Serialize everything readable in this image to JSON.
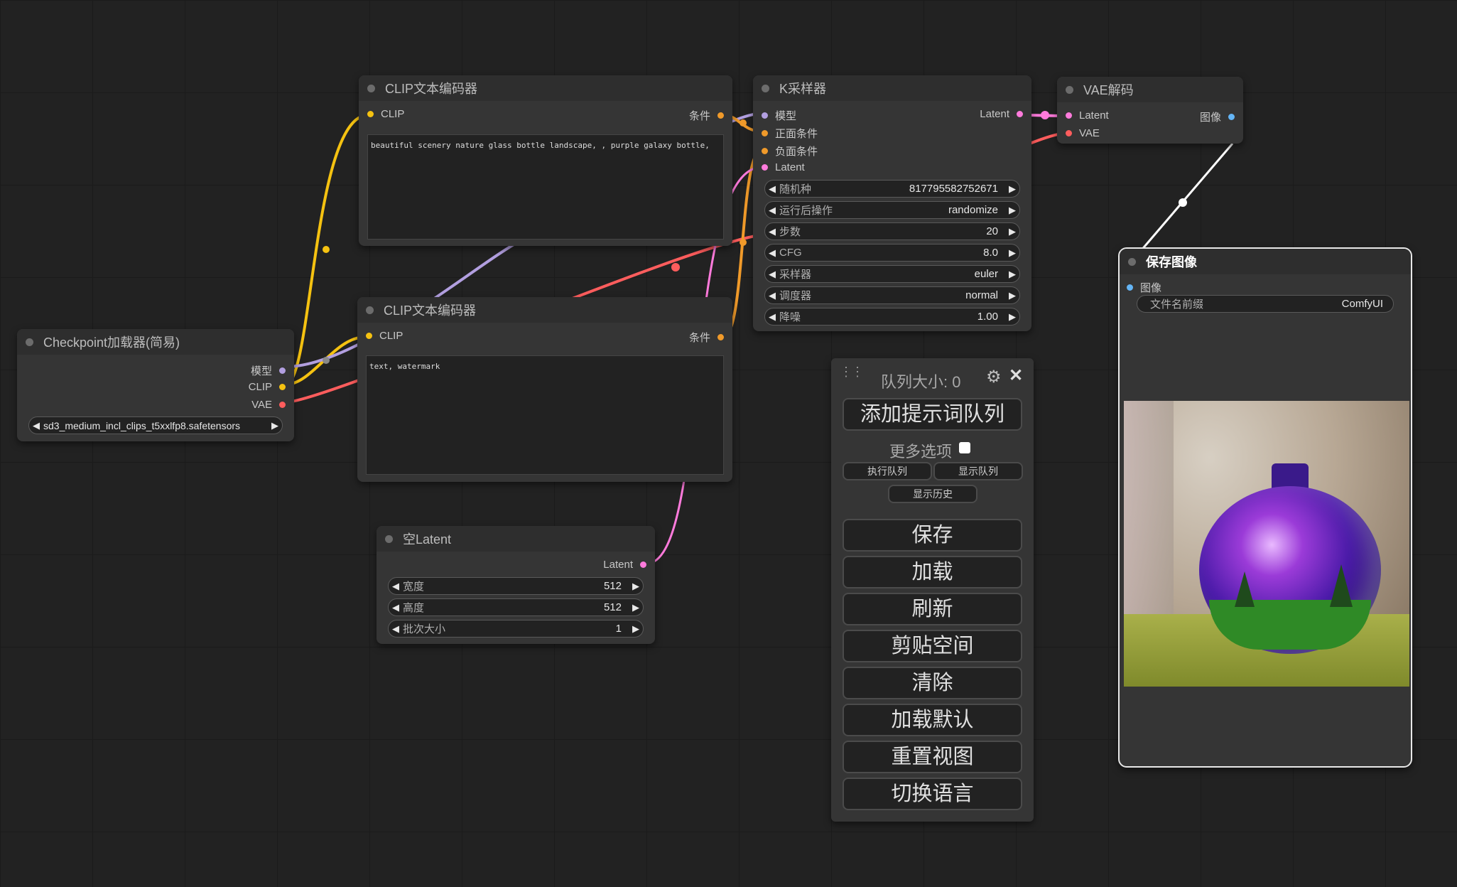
{
  "colors": {
    "background": "#222222",
    "clip_yellow": "#f5c211",
    "conditioning_orange": "#f09a2a",
    "latent_pink": "#ff7bdc",
    "vae_red": "#ff5d5d",
    "model_lavender": "#b29fe0",
    "image_blue": "#64b5f6",
    "image_wire": "#ffffff"
  },
  "nodes": {
    "checkpoint": {
      "title": "Checkpoint加载器(简易)",
      "outputs": [
        "模型",
        "CLIP",
        "VAE"
      ],
      "ckpt_value": "sd3_medium_incl_clips_t5xxlfp8.safetensors"
    },
    "clip_pos": {
      "title": "CLIP文本编码器",
      "input": "CLIP",
      "output": "条件",
      "text": "beautiful scenery nature glass bottle landscape, , purple galaxy bottle,"
    },
    "clip_neg": {
      "title": "CLIP文本编码器",
      "input": "CLIP",
      "output": "条件",
      "text": "text, watermark"
    },
    "ksampler": {
      "title": "K采样器",
      "inputs": [
        "模型",
        "正面条件",
        "负面条件",
        "Latent"
      ],
      "output": "Latent",
      "widgets": [
        {
          "label": "随机种",
          "value": "817795582752671"
        },
        {
          "label": "运行后操作",
          "value": "randomize"
        },
        {
          "label": "步数",
          "value": "20"
        },
        {
          "label": "CFG",
          "value": "8.0"
        },
        {
          "label": "采样器",
          "value": "euler"
        },
        {
          "label": "调度器",
          "value": "normal"
        },
        {
          "label": "降噪",
          "value": "1.00"
        }
      ]
    },
    "vae_decode": {
      "title": "VAE解码",
      "inputs": [
        "Latent",
        "VAE"
      ],
      "output": "图像"
    },
    "empty_latent": {
      "title": "空Latent",
      "output": "Latent",
      "widgets": [
        {
          "label": "宽度",
          "value": "512"
        },
        {
          "label": "高度",
          "value": "512"
        },
        {
          "label": "批次大小",
          "value": "1"
        }
      ]
    },
    "save_image": {
      "title": "保存图像",
      "input": "图像",
      "widget": {
        "label": "文件名前缀",
        "value": "ComfyUI"
      }
    }
  },
  "queue_panel": {
    "drag_icon": "drag-handle-icon",
    "queue_size_label": "队列大小: 0",
    "settings_icon": "gear-icon",
    "close_icon": "close-icon",
    "queue_prompt": "添加提示词队列",
    "more_options": "更多选项",
    "run_queue": "执行队列",
    "view_queue": "显示队列",
    "view_history": "显示历史",
    "save": "保存",
    "load": "加载",
    "refresh": "刷新",
    "clipspace": "剪贴空间",
    "clear": "清除",
    "load_default": "加载默认",
    "reset_view": "重置视图",
    "switch_locale": "切换语言"
  }
}
